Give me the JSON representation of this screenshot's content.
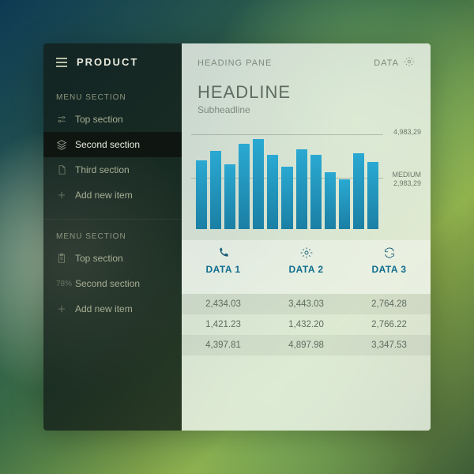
{
  "brand": "PRODUCT",
  "menus": [
    {
      "title": "MENU SECTION",
      "items": [
        {
          "icon": "sliders",
          "label": "Top section",
          "active": false
        },
        {
          "icon": "layers",
          "label": "Second section",
          "active": true
        },
        {
          "icon": "file",
          "label": "Third section",
          "active": false
        },
        {
          "icon": "plus",
          "label": "Add new item",
          "active": false
        }
      ]
    },
    {
      "title": "MENU SECTION",
      "items": [
        {
          "icon": "clipboard",
          "label": "Top section",
          "active": false
        },
        {
          "icon": "pct",
          "pct": "78%",
          "label": "Second section",
          "active": false
        },
        {
          "icon": "plus",
          "label": "Add new item",
          "active": false
        }
      ]
    }
  ],
  "topbar": {
    "heading": "HEADING PANE",
    "data_label": "DATA"
  },
  "headline": "HEADLINE",
  "subheadline": "Subheadline",
  "axis": {
    "top": "4,983,29",
    "mid_label": "MEDIUM",
    "mid": "2,983,29"
  },
  "chart_data": {
    "type": "bar",
    "title": "HEADLINE",
    "ylim": [
      0,
      4983.29
    ],
    "reference_lines": [
      {
        "label": "",
        "value": 4983.29
      },
      {
        "label": "MEDIUM",
        "value": 2983.29
      }
    ],
    "values": [
      3600,
      4100,
      3400,
      4500,
      4750,
      3900,
      3300,
      4200,
      3900,
      3000,
      2600,
      4000,
      3550
    ]
  },
  "table": {
    "columns": [
      {
        "icon": "phone",
        "label": "DATA 1"
      },
      {
        "icon": "gear",
        "label": "DATA 2"
      },
      {
        "icon": "refresh",
        "label": "DATA 3"
      }
    ],
    "rows": [
      [
        "2,434.03",
        "3,443.03",
        "2,764.28"
      ],
      [
        "1,421.23",
        "1,432.20",
        "2,766.22"
      ],
      [
        "4,397.81",
        "4,897.98",
        "3,347.53"
      ]
    ]
  }
}
